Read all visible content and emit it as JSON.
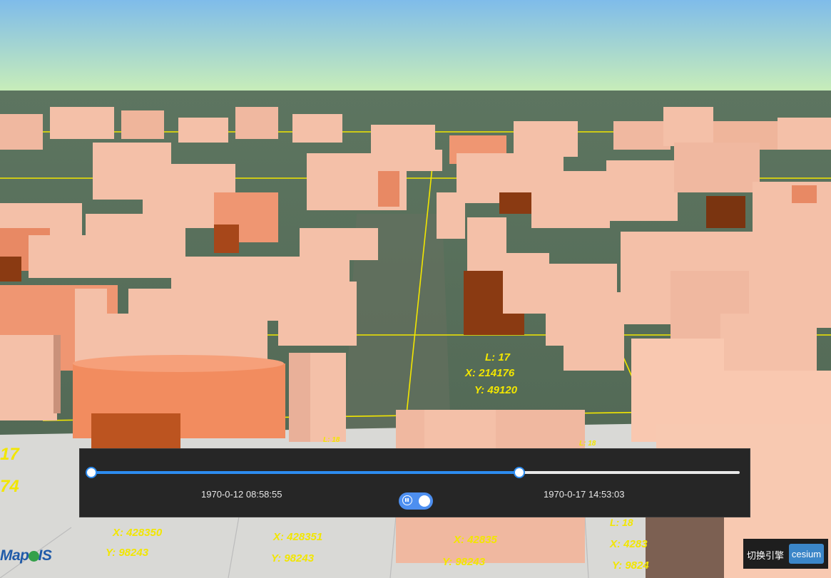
{
  "map": {
    "tile_labels": [
      {
        "level": "L: 17",
        "x": "X: 214176",
        "y": "Y: 49120"
      },
      {
        "level": "L: 18",
        "x": "",
        "y": ""
      },
      {
        "level": "L: 18",
        "x": "",
        "y": ""
      },
      {
        "level": "",
        "x": "X: 428350",
        "y": "Y: 98243"
      },
      {
        "level": "",
        "x": "X: 428351",
        "y": "Y: 98243"
      },
      {
        "level": "",
        "x": "X: 42835",
        "y": "Y: 98243"
      },
      {
        "level": "L: 18",
        "x": "X: 4283",
        "y": "Y: 9824"
      }
    ],
    "edge_labels": [
      "17",
      "74"
    ]
  },
  "timeline": {
    "start_label": "1970-0-12 08:58:55",
    "end_label": "1970-0-17 14:53:03",
    "progress": 0.66,
    "play_state": "playing"
  },
  "engine_switch": {
    "label": "切换引擎",
    "button_label": "cesium"
  },
  "logo": {
    "text_before": "Map",
    "text_after": "IS"
  },
  "colors": {
    "sky_top": "#7fbcea",
    "sky_bottom": "#c9eeb8",
    "building_light": "#f4c0a8",
    "building_mid": "#ef9672",
    "building_dark": "#8a3a12",
    "grid_line": "#f2e600",
    "slider_accent": "#2d8cf0",
    "panel_bg": "#262626"
  }
}
